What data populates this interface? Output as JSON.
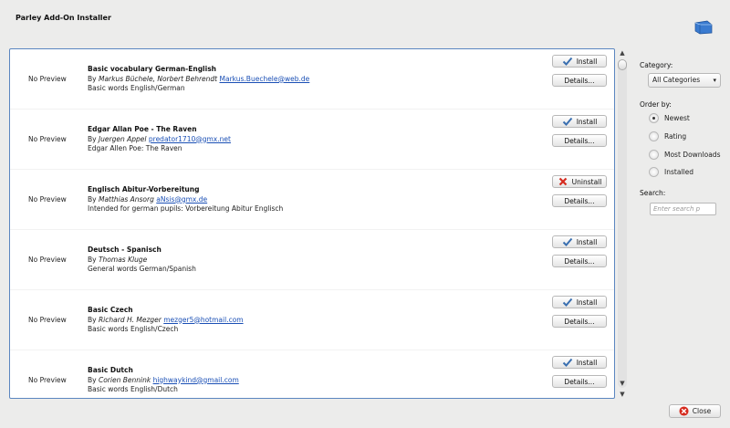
{
  "window": {
    "title": "Parley Add-On Installer"
  },
  "items": [
    {
      "preview": "No Preview",
      "name": "Basic vocabulary German-English",
      "by_prefix": "By ",
      "author": "Markus Büchele, Norbert Behrendt",
      "email": "Markus.Buechele@web.de",
      "description": "Basic words English/German",
      "action": "Install",
      "details": "Details..."
    },
    {
      "preview": "No Preview",
      "name": "Edgar Allan Poe - The Raven",
      "by_prefix": "By ",
      "author": "Juergen Appel",
      "email": "predator1710@gmx.net",
      "description": "Edgar Allen Poe: The Raven",
      "action": "Install",
      "details": "Details..."
    },
    {
      "preview": "No Preview",
      "name": "Englisch Abitur-Vorbereitung",
      "by_prefix": "By ",
      "author": "Matthias Ansorg",
      "email": "aNsis@gmx.de",
      "description": "Intended for german pupils: Vorbereitung Abitur Englisch",
      "action": "Uninstall",
      "details": "Details..."
    },
    {
      "preview": "No Preview",
      "name": "Deutsch - Spanisch",
      "by_prefix": "By ",
      "author": "Thomas Kluge",
      "email": "",
      "description": "General words German/Spanish",
      "action": "Install",
      "details": "Details..."
    },
    {
      "preview": "No Preview",
      "name": "Basic Czech",
      "by_prefix": "By ",
      "author": "Richard H. Mezger",
      "email": "mezger5@hotmail.com",
      "description": "Basic words English/Czech",
      "action": "Install",
      "details": "Details..."
    },
    {
      "preview": "No Preview",
      "name": "Basic Dutch",
      "by_prefix": "By ",
      "author": "Corien Bennink",
      "email": "highwaykind@gmail.com",
      "description": "Basic words English/Dutch",
      "action": "Install",
      "details": "Details..."
    }
  ],
  "sidebar": {
    "category_label": "Category:",
    "category_value": "All Categories",
    "order_label": "Order by:",
    "order_options": [
      "Newest",
      "Rating",
      "Most Downloads",
      "Installed"
    ],
    "order_selected": "Newest",
    "search_label": "Search:",
    "search_placeholder": "Enter search p"
  },
  "footer": {
    "close_label": "Close"
  },
  "colors": {
    "link": "#1a4fb5",
    "frame_border": "#5b86c0",
    "uninstall_icon": "#d62b1f",
    "install_icon": "#3a6fb0"
  }
}
